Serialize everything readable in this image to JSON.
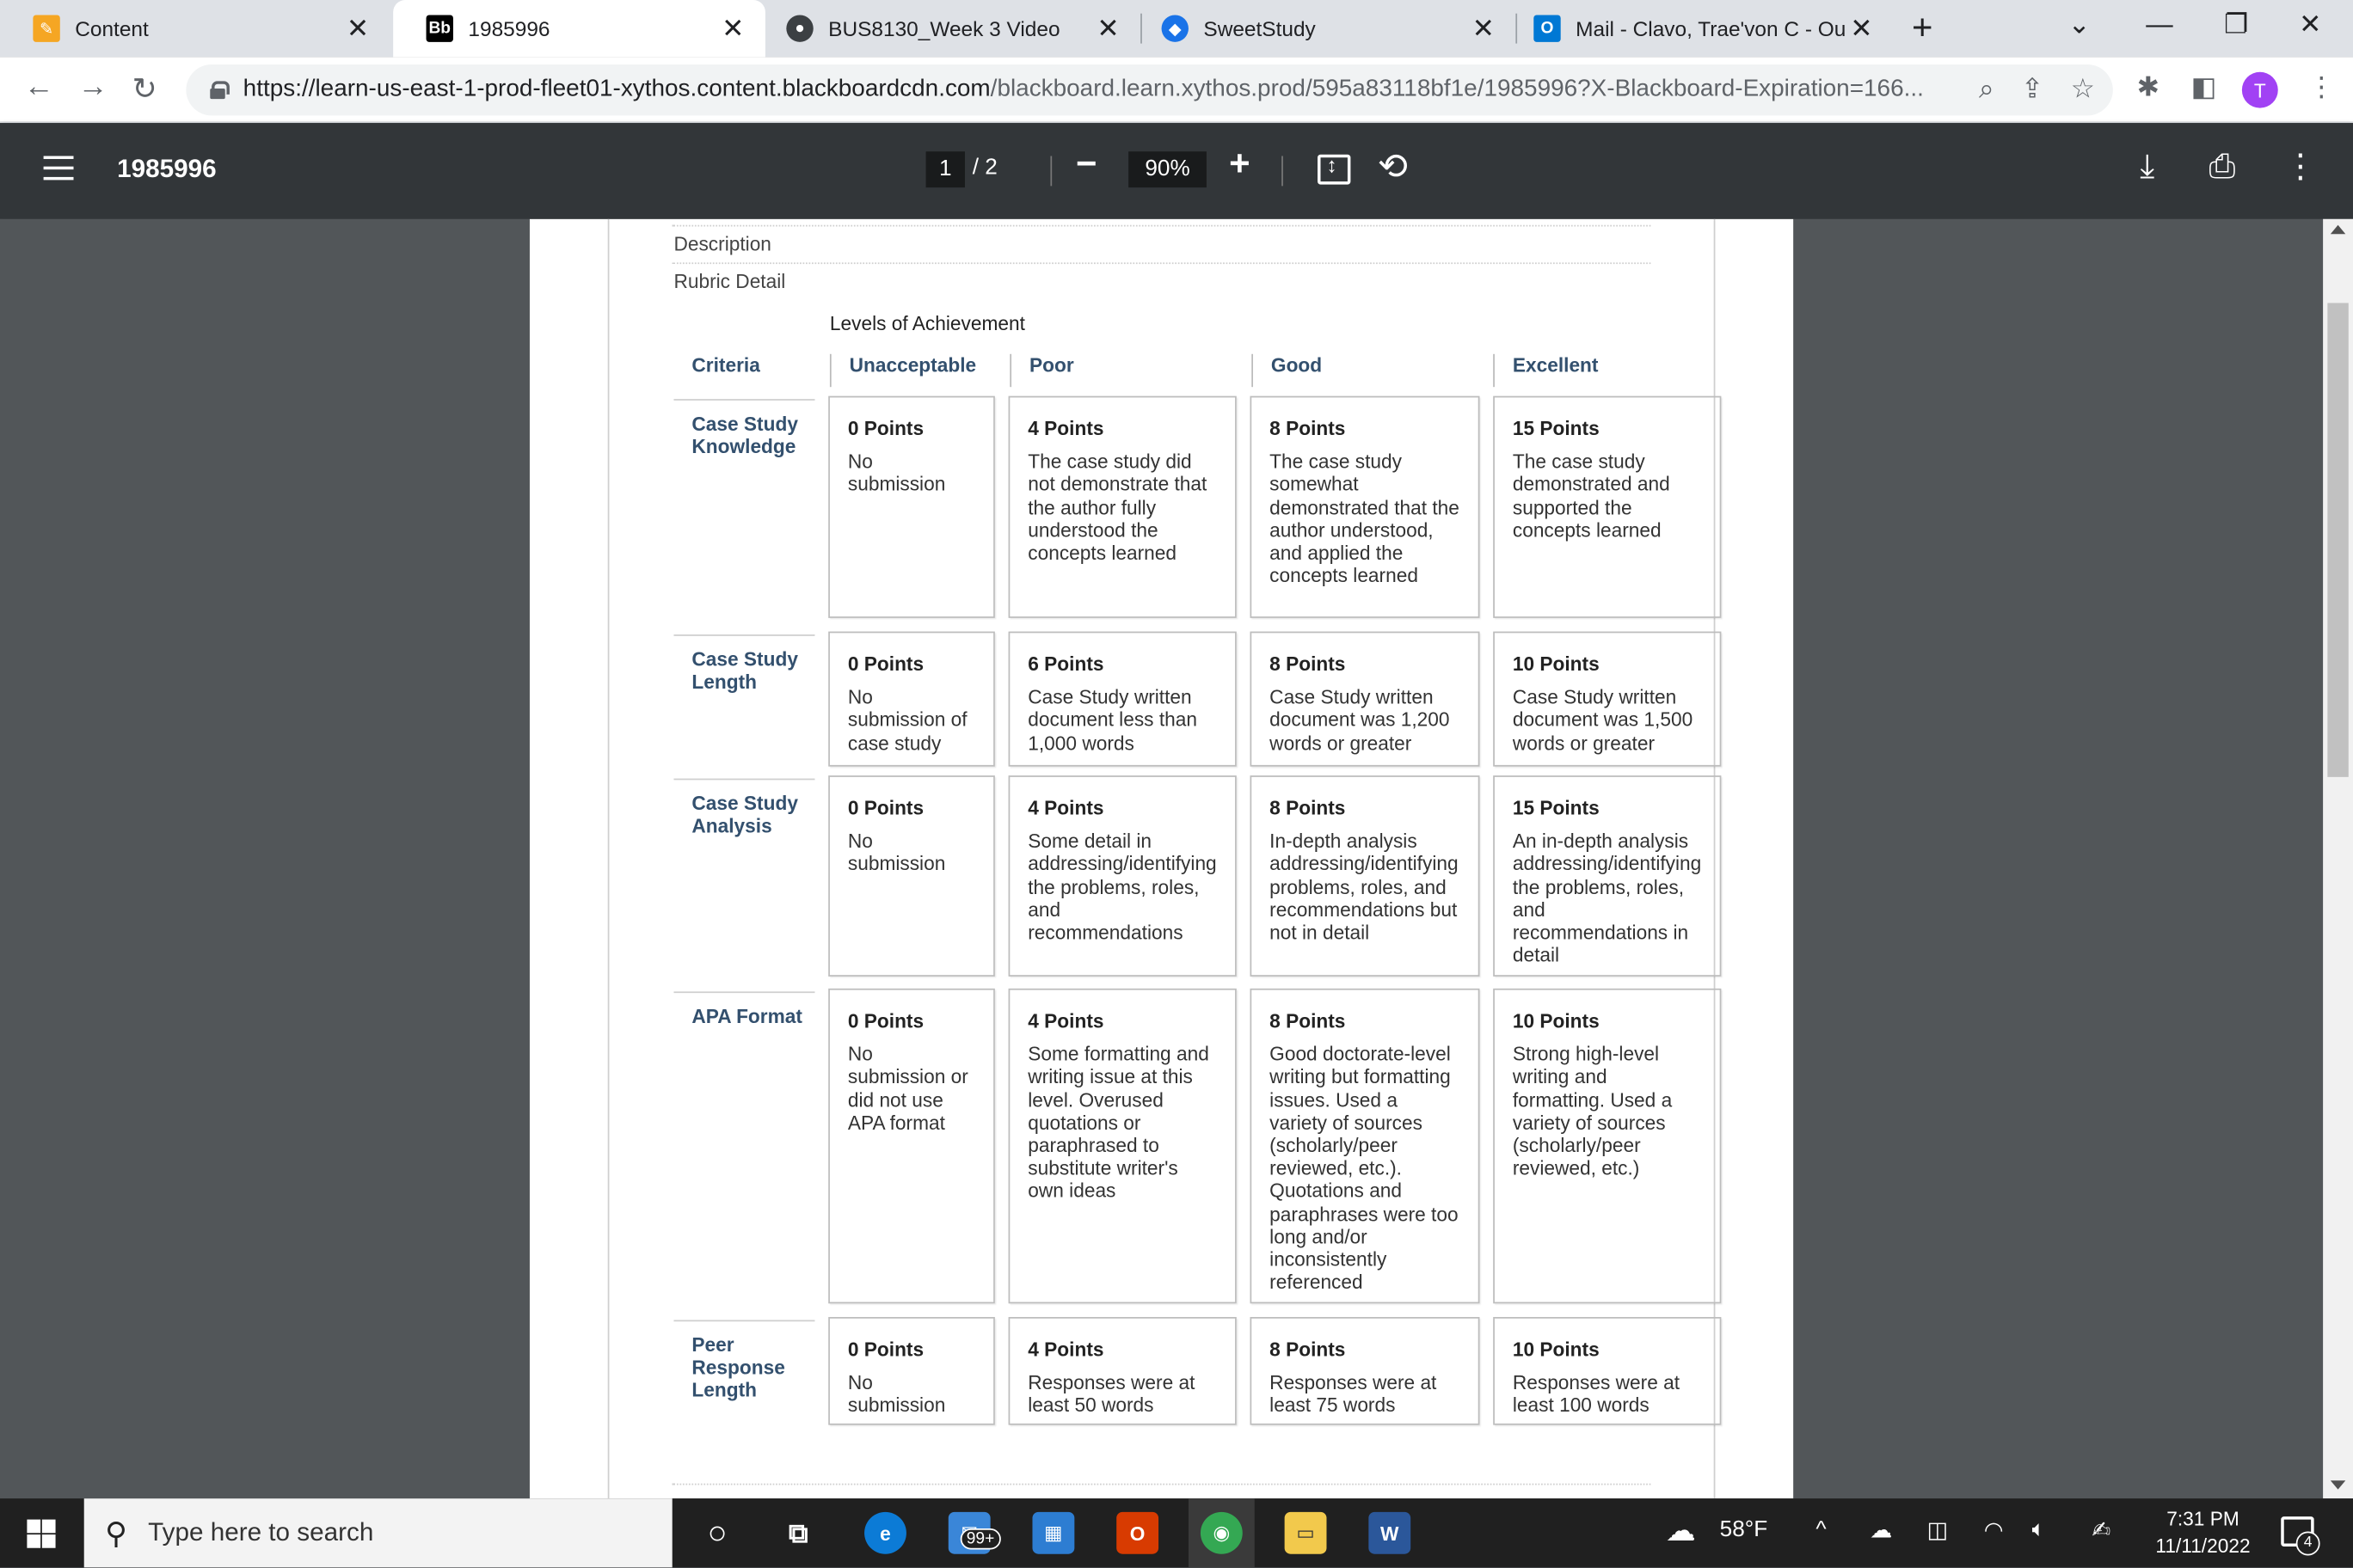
{
  "tabs": [
    {
      "label": "Content",
      "icon": "pencil-icon",
      "color": "#f5a623"
    },
    {
      "label": "1985996",
      "icon": "blackboard-icon",
      "favicon_text": "Bb",
      "color": "#000000"
    },
    {
      "label": "BUS8130_Week 3 Video",
      "icon": "video-icon",
      "color": "#3c4043"
    },
    {
      "label": "SweetStudy",
      "icon": "sweetstudy-icon",
      "color": "#1a73e8"
    },
    {
      "label": "Mail - Clavo, Trae'von C - Out",
      "icon": "outlook-icon",
      "favicon_text": "O",
      "color": "#0078d4"
    }
  ],
  "address": {
    "host": "https://learn-us-east-1-prod-fleet01-xythos.content.blackboardcdn.com",
    "path": "/blackboard.learn.xythos.prod/595a83118bf1e/1985996?X-Blackboard-Expiration=166..."
  },
  "profile_initial": "T",
  "pdf": {
    "title": "1985996",
    "current_page": "1",
    "total_pages": "/  2",
    "zoom": "90%"
  },
  "doc": {
    "description_label": "Description",
    "rubric_detail_label": "Rubric Detail",
    "levels_label": "Levels of Achievement",
    "criteria_header": "Criteria",
    "level_headers": [
      "Unacceptable",
      "Poor",
      "Good",
      "Excellent"
    ],
    "rows": [
      {
        "criterion": "Case Study Knowledge",
        "cells": [
          {
            "points": "0 Points",
            "desc": "No submission"
          },
          {
            "points": "4 Points",
            "desc": "The case study did not demonstrate that the author fully understood the concepts learned"
          },
          {
            "points": "8 Points",
            "desc": "The case study somewhat demonstrated that the author understood, and applied the concepts learned"
          },
          {
            "points": "15 Points",
            "desc": "The case study demonstrated and supported the concepts learned"
          }
        ]
      },
      {
        "criterion": "Case Study Length",
        "cells": [
          {
            "points": "0 Points",
            "desc": "No submission of case study"
          },
          {
            "points": "6 Points",
            "desc": "Case Study written document less than 1,000 words"
          },
          {
            "points": "8 Points",
            "desc": "Case Study written document was 1,200 words or greater"
          },
          {
            "points": "10 Points",
            "desc": "Case Study written document was 1,500 words or greater"
          }
        ]
      },
      {
        "criterion": "Case Study Analysis",
        "cells": [
          {
            "points": "0 Points",
            "desc": "No submission"
          },
          {
            "points": "4 Points",
            "desc": "Some detail in addressing/identifying the problems, roles, and recommendations"
          },
          {
            "points": "8 Points",
            "desc": "In-depth analysis addressing/identifying problems, roles, and recommendations but not in detail"
          },
          {
            "points": "15 Points",
            "desc": "An in-depth analysis addressing/identifying the problems, roles, and recommendations in detail"
          }
        ]
      },
      {
        "criterion": "APA Format",
        "cells": [
          {
            "points": "0 Points",
            "desc": "No submission or did not use APA format"
          },
          {
            "points": "4 Points",
            "desc": "Some formatting and writing issue at this level. Overused quotations or paraphrased to substitute writer's own ideas"
          },
          {
            "points": "8 Points",
            "desc": "Good doctorate-level writing but formatting issues. Used a variety of sources (scholarly/peer reviewed, etc.). Quotations and paraphrases were too long and/or inconsistently referenced"
          },
          {
            "points": "10 Points",
            "desc": "Strong high-level writing and formatting. Used a variety of sources (scholarly/peer reviewed, etc.)"
          }
        ]
      },
      {
        "criterion": "Peer Response Length",
        "cells": [
          {
            "points": "0 Points",
            "desc": "No submission"
          },
          {
            "points": "4 Points",
            "desc": "Responses were at least 50 words"
          },
          {
            "points": "8 Points",
            "desc": "Responses were at least 75 words"
          },
          {
            "points": "10 Points",
            "desc": "Responses were at least 100 words"
          }
        ]
      }
    ]
  },
  "taskbar": {
    "search_placeholder": "Type here to search",
    "mail_badge": "99+",
    "weather": "58°F",
    "time": "7:31 PM",
    "date": "11/11/2022",
    "notifications": "4"
  },
  "colors": {
    "accent_header": "#33506e",
    "pdf_toolbar": "#323639",
    "viewer_bg": "#525659"
  }
}
